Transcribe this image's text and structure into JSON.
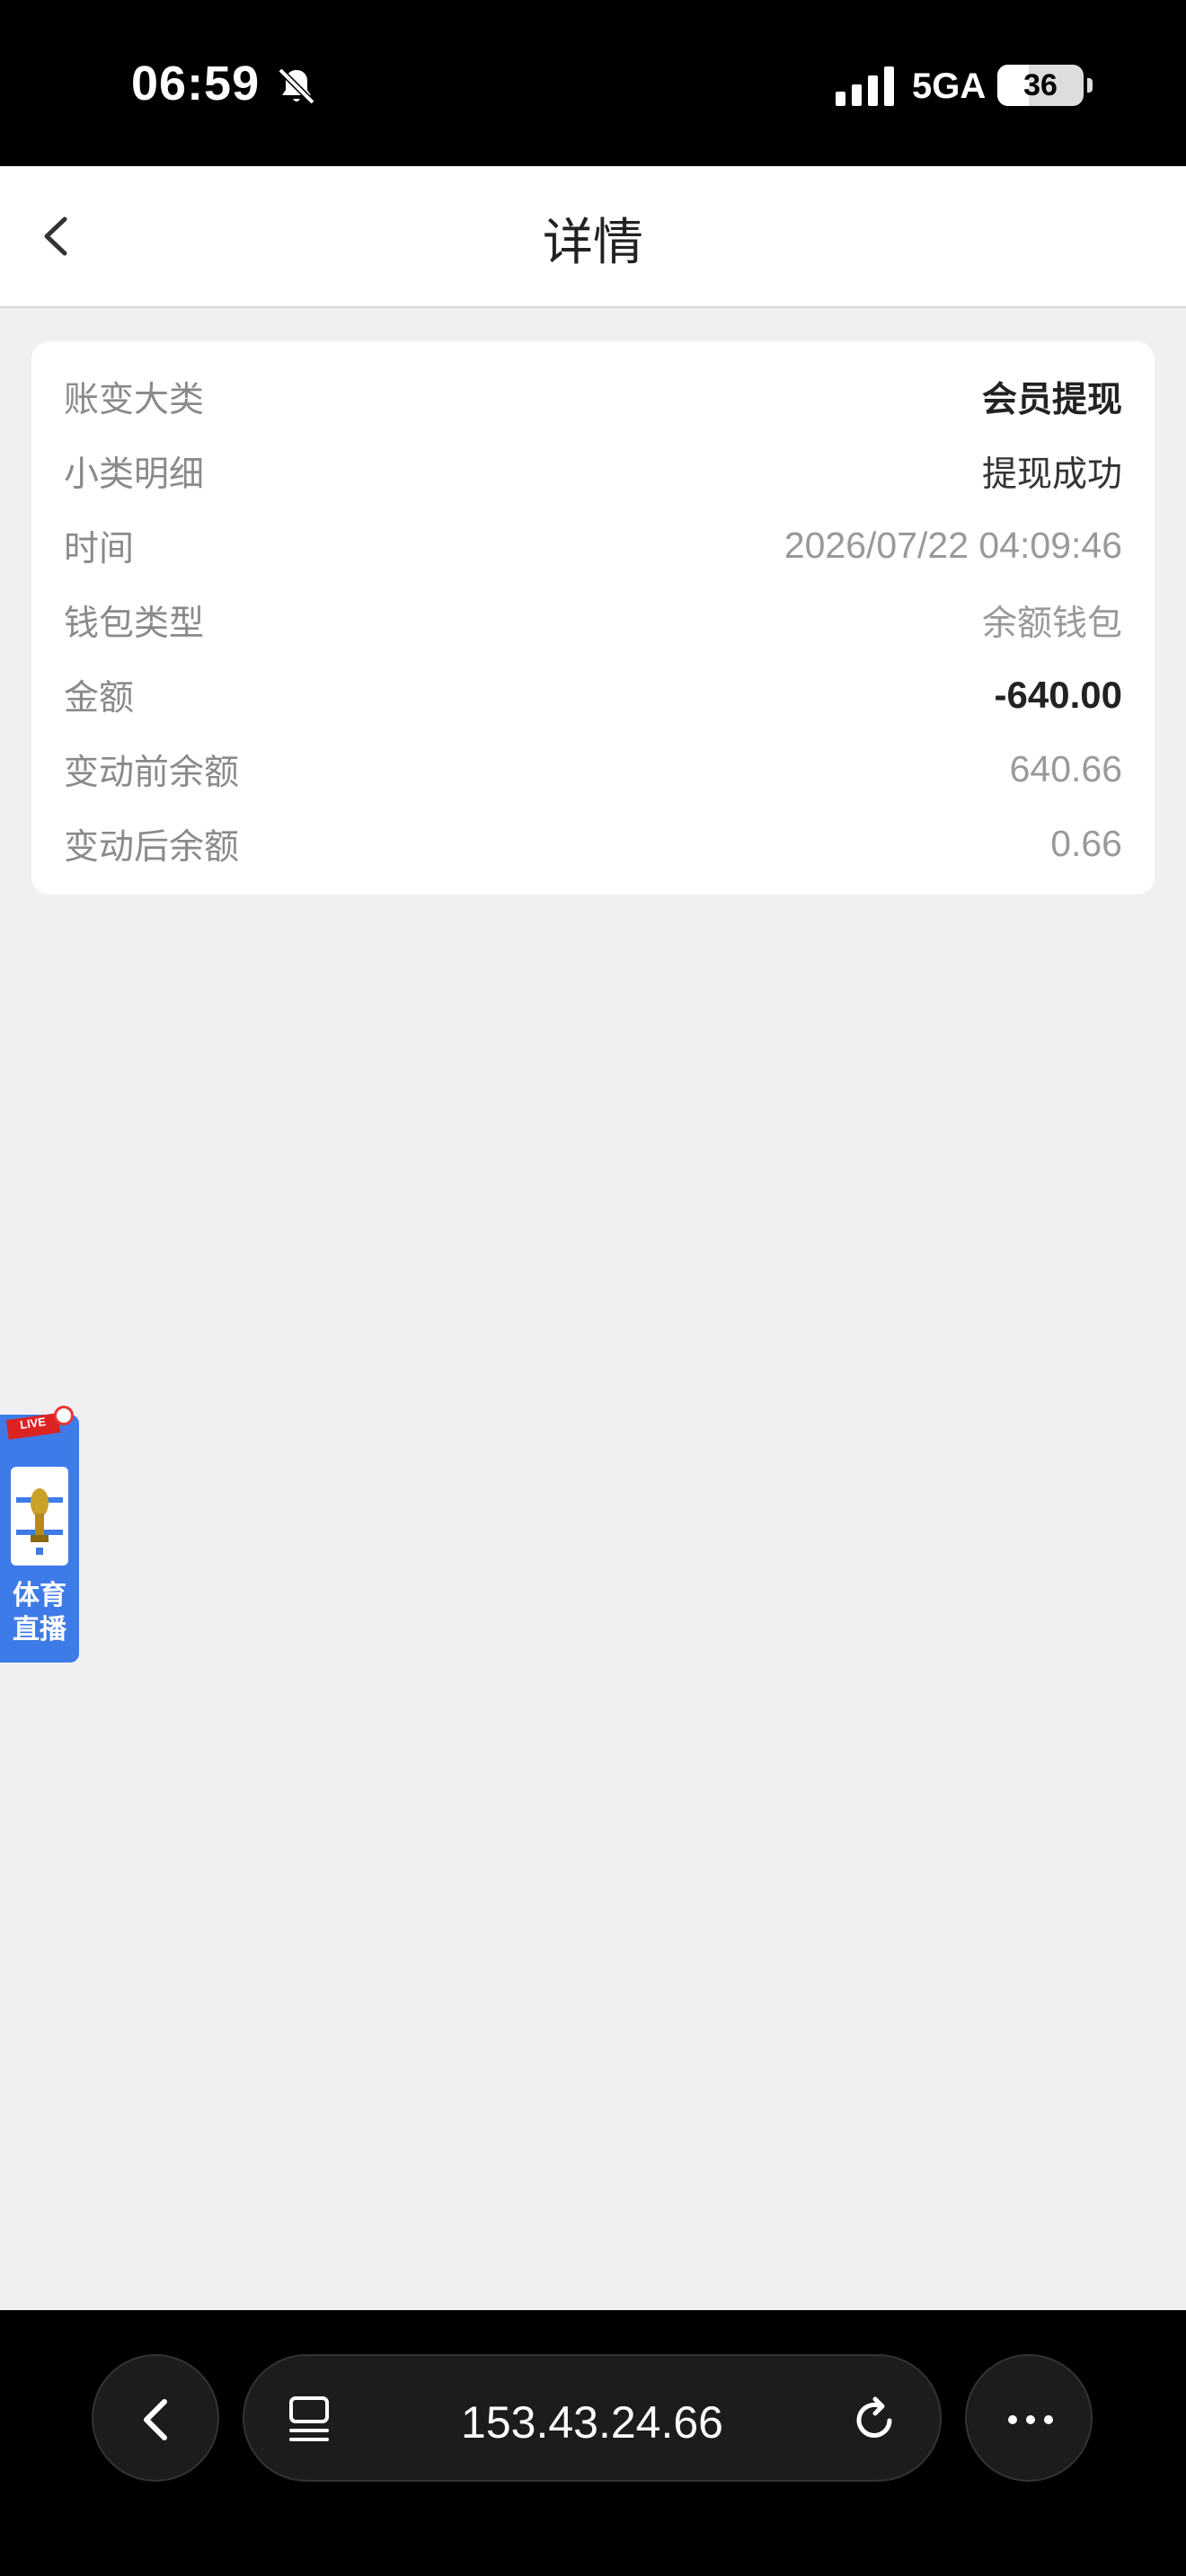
{
  "status_bar": {
    "time": "06:59",
    "network": "5GA",
    "battery": "36",
    "battery_level_percent": 36
  },
  "header": {
    "title": "详情"
  },
  "detail_card": {
    "rows": [
      {
        "label": "账变大类",
        "value": "会员提现"
      },
      {
        "label": "小类明细",
        "value": "提现成功"
      },
      {
        "label": "时间",
        "value": "2026/07/22 04:09:46"
      },
      {
        "label": "钱包类型",
        "value": "余额钱包"
      },
      {
        "label": "金额",
        "value": "-640.00"
      },
      {
        "label": "变动前余额",
        "value": "640.66"
      },
      {
        "label": "变动后余额",
        "value": "0.66"
      }
    ]
  },
  "floating_widget": {
    "badge": "LIVE",
    "label_line1": "体育",
    "label_line2": "直播"
  },
  "browser_bar": {
    "url": "153.43.24.66"
  },
  "colors": {
    "page_bg": "#f0f0f2",
    "card_bg": "#ffffff",
    "widget_blue": "#3d7be8",
    "bar_bg": "#000000"
  }
}
